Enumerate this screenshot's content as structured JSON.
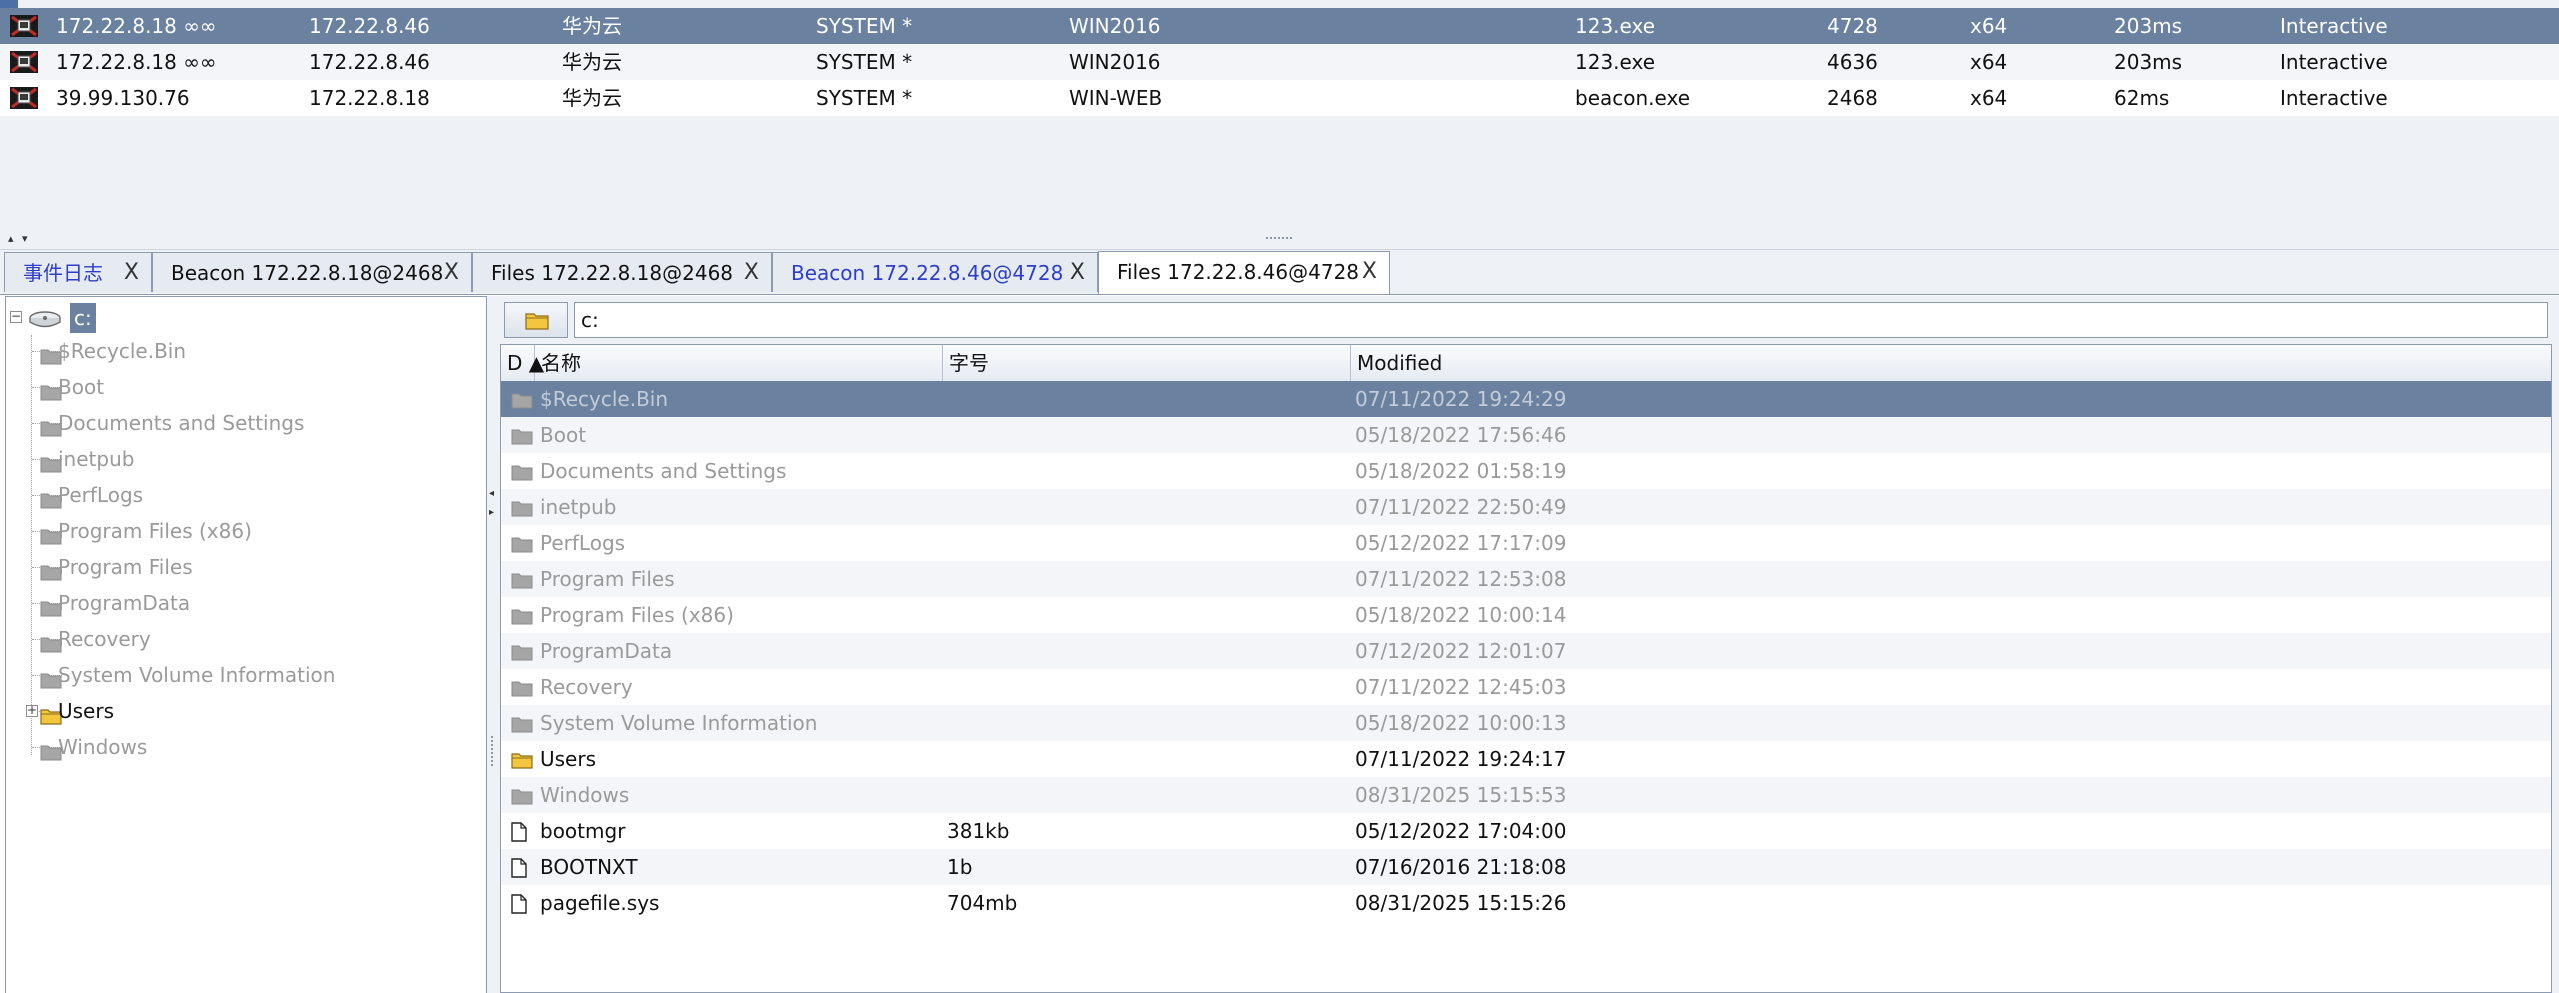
{
  "sessions": {
    "rows": [
      {
        "external": "172.22.8.18 ∞∞",
        "internal": "172.22.8.46",
        "listener": "华为云",
        "user": "SYSTEM *",
        "computer": "WIN2016",
        "process": "123.exe",
        "pid": "4728",
        "arch": "x64",
        "last": "203ms",
        "type": "Interactive",
        "selected": true
      },
      {
        "external": "172.22.8.18 ∞∞",
        "internal": "172.22.8.46",
        "listener": "华为云",
        "user": "SYSTEM *",
        "computer": "WIN2016",
        "process": "123.exe",
        "pid": "4636",
        "arch": "x64",
        "last": "203ms",
        "type": "Interactive",
        "selected": false
      },
      {
        "external": "39.99.130.76",
        "internal": "172.22.8.18",
        "listener": "华为云",
        "user": "SYSTEM *",
        "computer": "WIN-WEB",
        "process": "beacon.exe",
        "pid": "2468",
        "arch": "x64",
        "last": "62ms",
        "type": "Interactive",
        "selected": false
      }
    ]
  },
  "tabs": [
    {
      "label": "事件日志",
      "close": "X",
      "color": "blue",
      "active": false
    },
    {
      "label": "Beacon 172.22.8.18@2468",
      "close": "X",
      "color": "black",
      "active": false
    },
    {
      "label": "Files 172.22.8.18@2468",
      "close": "X",
      "color": "black",
      "active": false
    },
    {
      "label": "Beacon 172.22.8.46@4728",
      "close": "X",
      "color": "blue",
      "active": false
    },
    {
      "label": "Files 172.22.8.46@4728",
      "close": "X",
      "color": "black",
      "active": true
    }
  ],
  "tree": {
    "root": "c:",
    "children": [
      {
        "label": "$Recycle.Bin",
        "accessible": false
      },
      {
        "label": "Boot",
        "accessible": false
      },
      {
        "label": "Documents and Settings",
        "accessible": false
      },
      {
        "label": "inetpub",
        "accessible": false
      },
      {
        "label": "PerfLogs",
        "accessible": false
      },
      {
        "label": "Program Files (x86)",
        "accessible": false
      },
      {
        "label": "Program Files",
        "accessible": false
      },
      {
        "label": "ProgramData",
        "accessible": false
      },
      {
        "label": "Recovery",
        "accessible": false
      },
      {
        "label": "System Volume Information",
        "accessible": false
      },
      {
        "label": "Users",
        "accessible": true,
        "expandable": true,
        "expander": "+"
      },
      {
        "label": "Windows",
        "accessible": false
      }
    ]
  },
  "files": {
    "path": "c:",
    "columns": {
      "d": "D ▲",
      "name": "名称",
      "size": "字号",
      "modified": "Modified"
    },
    "rows": [
      {
        "icon": "folder",
        "name": "$Recycle.Bin",
        "size": "",
        "modified": "07/11/2022 19:24:29",
        "accessible": false,
        "selected": true
      },
      {
        "icon": "folder",
        "name": "Boot",
        "size": "",
        "modified": "05/18/2022 17:56:46",
        "accessible": false
      },
      {
        "icon": "folder",
        "name": "Documents and Settings",
        "size": "",
        "modified": "05/18/2022 01:58:19",
        "accessible": false
      },
      {
        "icon": "folder",
        "name": "inetpub",
        "size": "",
        "modified": "07/11/2022 22:50:49",
        "accessible": false
      },
      {
        "icon": "folder",
        "name": "PerfLogs",
        "size": "",
        "modified": "05/12/2022 17:17:09",
        "accessible": false
      },
      {
        "icon": "folder",
        "name": "Program Files",
        "size": "",
        "modified": "07/11/2022 12:53:08",
        "accessible": false
      },
      {
        "icon": "folder",
        "name": "Program Files (x86)",
        "size": "",
        "modified": "05/18/2022 10:00:14",
        "accessible": false
      },
      {
        "icon": "folder",
        "name": "ProgramData",
        "size": "",
        "modified": "07/12/2022 12:01:07",
        "accessible": false
      },
      {
        "icon": "folder",
        "name": "Recovery",
        "size": "",
        "modified": "07/11/2022 12:45:03",
        "accessible": false
      },
      {
        "icon": "folder",
        "name": "System Volume Information",
        "size": "",
        "modified": "05/18/2022 10:00:13",
        "accessible": false
      },
      {
        "icon": "folder-open",
        "name": "Users",
        "size": "",
        "modified": "07/11/2022 19:24:17",
        "accessible": true
      },
      {
        "icon": "folder",
        "name": "Windows",
        "size": "",
        "modified": "08/31/2025 15:15:53",
        "accessible": false
      },
      {
        "icon": "file",
        "name": "bootmgr",
        "size": "381kb",
        "modified": "05/12/2022 17:04:00",
        "accessible": true
      },
      {
        "icon": "file",
        "name": "BOOTNXT",
        "size": "1b",
        "modified": "07/16/2016 21:18:08",
        "accessible": true
      },
      {
        "icon": "file",
        "name": "pagefile.sys",
        "size": "704mb",
        "modified": "08/31/2025 15:15:26",
        "accessible": true
      }
    ]
  },
  "colors": {
    "selection": "#6a819f",
    "tab_blue_text": "#2e3ec8",
    "folder_yellow": "#f3c63d",
    "folder_gray": "#a6a6a6"
  }
}
